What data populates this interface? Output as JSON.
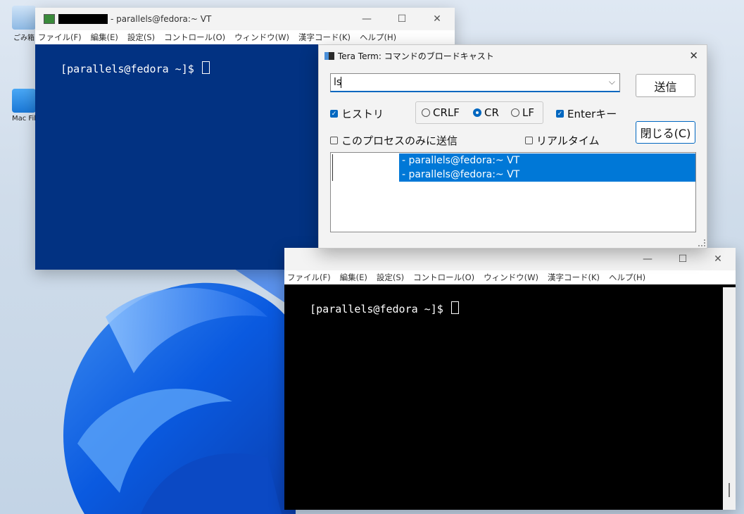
{
  "desktop": {
    "icons": [
      {
        "label": "ごみ箱"
      },
      {
        "label": "Mac Fil"
      }
    ]
  },
  "window1": {
    "title_redacted": "",
    "title": "- parallels@fedora:~ VT",
    "menu": [
      "ファイル(F)",
      "編集(E)",
      "設定(S)",
      "コントロール(O)",
      "ウィンドウ(W)",
      "漢字コード(K)",
      "ヘルプ(H)"
    ],
    "prompt": "[parallels@fedora ~]$ ",
    "bg_color": "#023282"
  },
  "window2": {
    "menu": [
      "ファイル(F)",
      "編集(E)",
      "設定(S)",
      "コントロール(O)",
      "ウィンドウ(W)",
      "漢字コード(K)",
      "ヘルプ(H)"
    ],
    "prompt": "[parallels@fedora ~]$ ",
    "bg_color": "#000000"
  },
  "dialog": {
    "title": "Tera Term: コマンドのブロードキャスト",
    "command_value": "ls",
    "send_label": "送信",
    "close_label": "閉じる(C)",
    "history_label": "ヒストリ",
    "history_checked": true,
    "crlf_label": "CRLF",
    "cr_label": "CR",
    "lf_label": "LF",
    "selected_newline": "CR",
    "enter_label": "Enterキー",
    "enter_checked": true,
    "this_process_label": "このプロセスのみに送信",
    "realtime_label": "リアルタイム",
    "list": [
      "- parallels@fedora:~ VT",
      "- parallels@fedora:~ VT"
    ],
    "accent": "#0067c0"
  }
}
